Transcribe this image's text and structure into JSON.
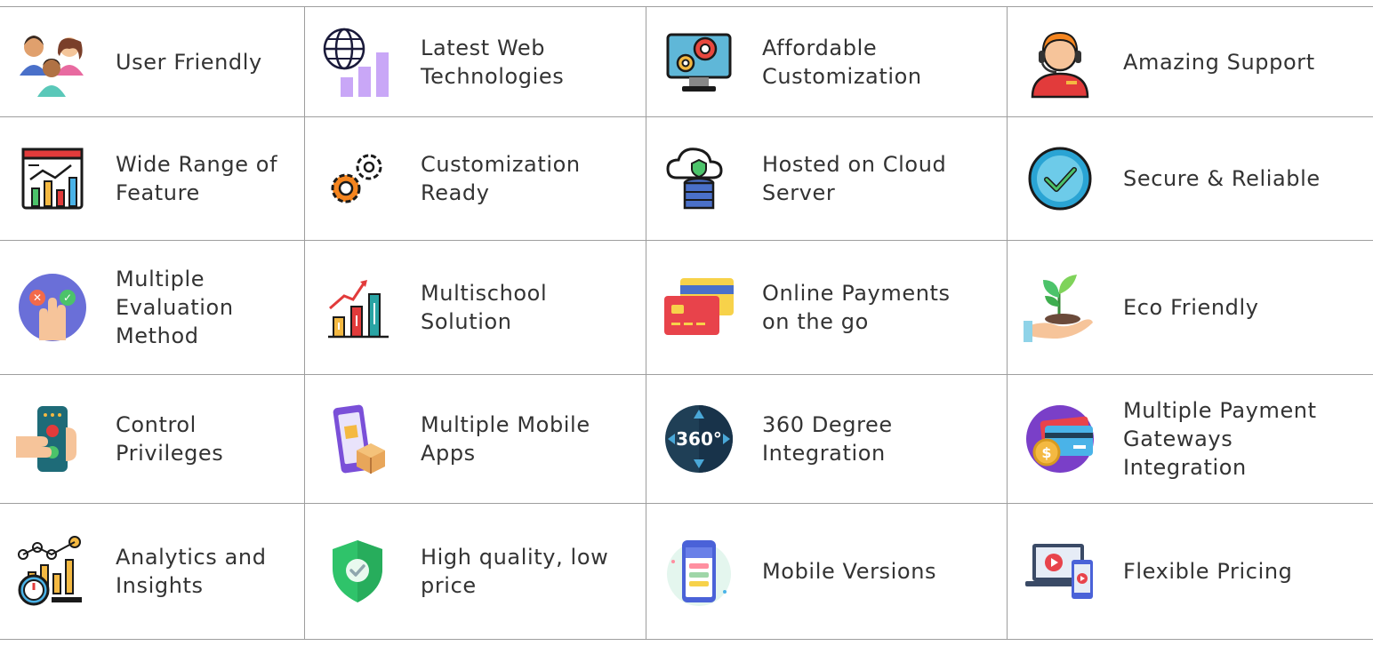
{
  "features": [
    {
      "label": "User Friendly",
      "icon": "users-group-icon"
    },
    {
      "label": "Latest Web Technologies",
      "icon": "globe-chart-icon"
    },
    {
      "label": "Affordable Customization",
      "icon": "monitor-gear-icon"
    },
    {
      "label": "Amazing Support",
      "icon": "support-agent-icon"
    },
    {
      "label": "Wide Range of Feature",
      "icon": "dashboard-chart-icon"
    },
    {
      "label": "Customization Ready",
      "icon": "gears-icon"
    },
    {
      "label": "Hosted on Cloud Server",
      "icon": "cloud-database-icon"
    },
    {
      "label": "Secure & Reliable",
      "icon": "check-circle-icon"
    },
    {
      "label": "Multiple Evaluation Method",
      "icon": "evaluation-hand-icon"
    },
    {
      "label": "Multischool Solution",
      "icon": "growth-bars-icon"
    },
    {
      "label": "Online Payments on the go",
      "icon": "payment-cards-icon"
    },
    {
      "label": "Eco Friendly",
      "icon": "plant-hand-icon"
    },
    {
      "label": "Control Privileges",
      "icon": "remote-control-icon"
    },
    {
      "label": "Multiple Mobile Apps",
      "icon": "phone-package-icon"
    },
    {
      "label": "360 Degree Integration",
      "icon": "360-degree-icon"
    },
    {
      "label": "Multiple Payment Gateways Integration",
      "icon": "card-coin-icon"
    },
    {
      "label": "Analytics and Insights",
      "icon": "analytics-icon"
    },
    {
      "label": "High quality, low price",
      "icon": "shield-check-icon"
    },
    {
      "label": "Mobile Versions",
      "icon": "mobile-app-icon"
    },
    {
      "label": "Flexible Pricing",
      "icon": "devices-video-icon"
    }
  ]
}
